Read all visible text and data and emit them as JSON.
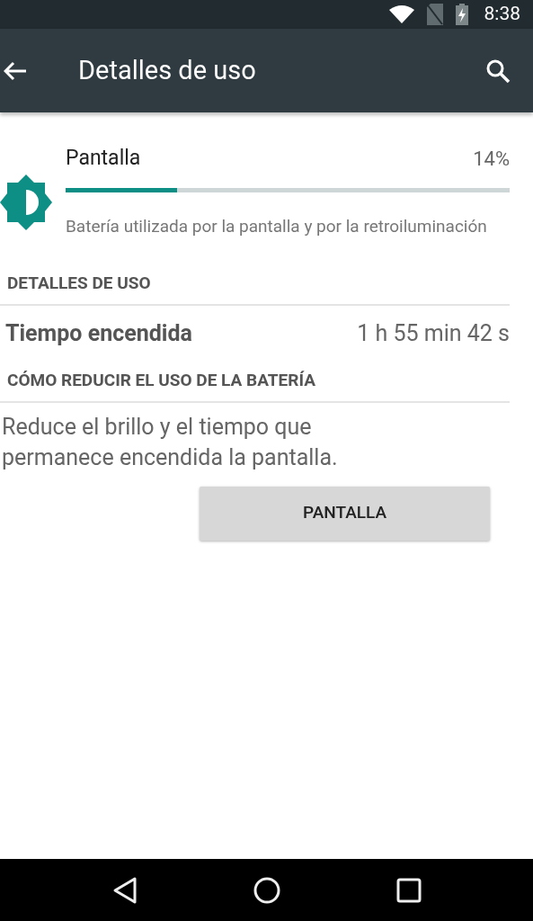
{
  "status_bar": {
    "time": "8:38"
  },
  "toolbar": {
    "title": "Detalles de uso"
  },
  "app": {
    "name": "Pantalla",
    "percent": "14%",
    "level": 0.25,
    "description": "Batería utilizada por la pantalla y por la retroiluminación"
  },
  "sections": [
    {
      "header": "DETALLES DE USO",
      "kind": "row",
      "label": "Tiempo encendida",
      "value": "1 h 55 min 42 s"
    },
    {
      "header": "CÓMO REDUCIR EL USO DE LA BATERÍA",
      "kind": "tip",
      "text": "Reduce el brillo y el tiempo que permanece encendida la pantalla.",
      "button": "PANTALLA"
    }
  ]
}
